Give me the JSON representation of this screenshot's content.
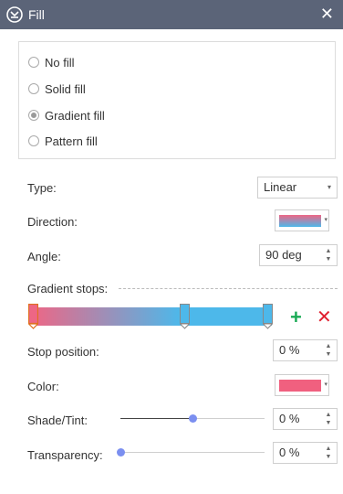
{
  "title": "Fill",
  "icons": {
    "app": "fill-icon",
    "close": "close-icon"
  },
  "fill_options": [
    {
      "label": "No fill",
      "selected": false
    },
    {
      "label": "Solid fill",
      "selected": false
    },
    {
      "label": "Gradient fill",
      "selected": true
    },
    {
      "label": "Pattern fill",
      "selected": false
    }
  ],
  "type": {
    "label": "Type:",
    "value": "Linear"
  },
  "direction": {
    "label": "Direction:"
  },
  "angle": {
    "label": "Angle:",
    "value": "90 deg"
  },
  "gradient_stops": {
    "label": "Gradient stops:"
  },
  "stop_position": {
    "label": "Stop position:",
    "value": "0 %"
  },
  "color": {
    "label": "Color:",
    "value": "#f0607f"
  },
  "shade_tint": {
    "label": "Shade/Tint:",
    "value": "0 %",
    "level": 0.5
  },
  "transparency": {
    "label": "Transparency:",
    "value": "0 %",
    "level": 0.0
  },
  "colors": {
    "titlebar": "#5b6478",
    "gradient_start": "#ee6685",
    "gradient_end": "#4db8ea",
    "add": "#1aaa55",
    "delete": "#e0202f",
    "slider_thumb": "#7b8ff0"
  }
}
